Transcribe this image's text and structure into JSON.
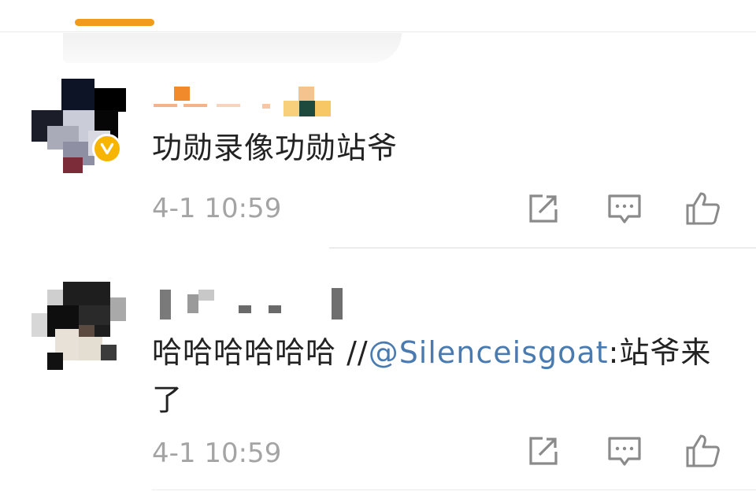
{
  "comments": [
    {
      "text": "功勋录像功勋站爷",
      "time": "4-1 10:59",
      "verified": true
    },
    {
      "text_prefix": "哈哈哈哈哈哈 //",
      "mention": "@Silenceisgoat",
      "text_suffix": ":站爷来了",
      "time": "4-1 10:59",
      "verified": false
    }
  ],
  "icons": {
    "share": "share-icon",
    "comment": "comment-icon",
    "like": "thumbs-up-icon",
    "verified": "verified-badge-icon"
  },
  "colors": {
    "tab_indicator": "#f29a19",
    "mention": "#4a7bb0",
    "timestamp": "#a4a4a4",
    "verified_badge": "#f7b500"
  }
}
